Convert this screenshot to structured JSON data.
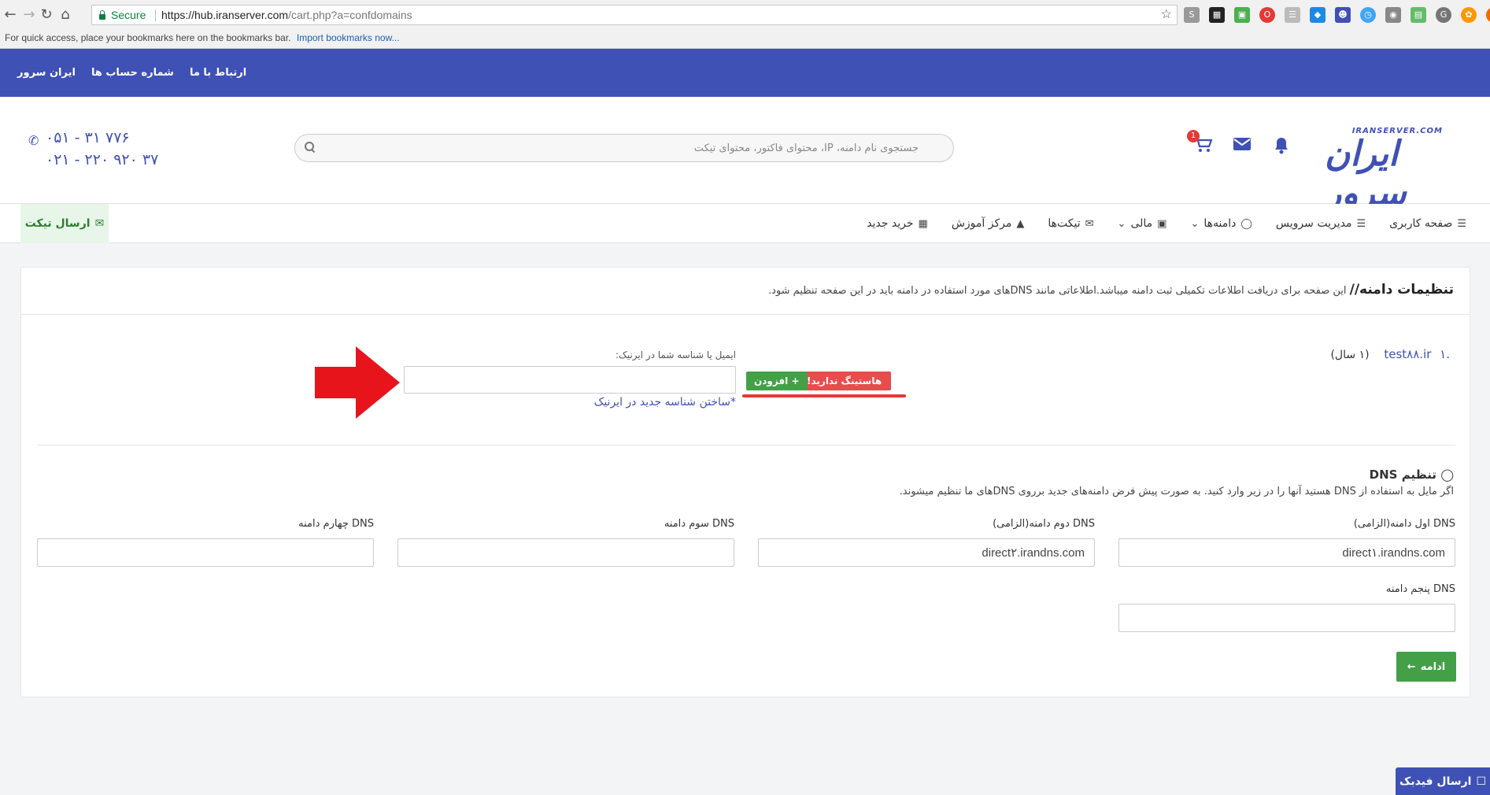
{
  "browser": {
    "secure_label": "Secure",
    "url_host": "https://hub.iranserver.com",
    "url_path": "/cart.php?a=confdomains",
    "bookmarks_hint": "For quick access, place your bookmarks here on the bookmarks bar.",
    "bookmarks_link": "Import bookmarks now..."
  },
  "topbar": {
    "links": [
      "ایران سرور",
      "شماره حساب ها",
      "ارتباط با ما"
    ]
  },
  "header": {
    "logo_tag": "IRANSERVER.COM",
    "logo_text": "ایران سرور",
    "cart_badge": "1",
    "search_placeholder": "جستجوی نام دامنه، IP، محتوای فاکتور، محتوای تیکت",
    "phone_1": "۰۵۱ - ۳۱ ۷۷۶",
    "phone_2": "۰۲۱ - ۲۲۰ ۹۲۰ ۳۷"
  },
  "nav": {
    "items": [
      {
        "label": "صفحه کاربری",
        "icon": "bars-icon"
      },
      {
        "label": "مدیریت سرویس",
        "icon": "list-icon"
      },
      {
        "label": "دامنه‌ها",
        "icon": "globe-icon"
      },
      {
        "label": "مالی",
        "icon": "briefcase-icon"
      },
      {
        "label": "تیکت‌ها",
        "icon": "comments-icon"
      },
      {
        "label": "مرکز آموزش",
        "icon": "graduation-cap-icon"
      },
      {
        "label": "خرید جدید",
        "icon": "grid-icon"
      }
    ],
    "send_ticket": "ارسال تیکت"
  },
  "card": {
    "title": "تنظیمات دامنه//",
    "subtitle": " این صفحه برای دریافت اطلاعات تکمیلی ثبت دامنه میباشد.اطلاعاتی مانند DNSهای مورد استفاده در دامنه باید در این صفحه تنظیم شود.",
    "domain_num": ".۱",
    "domain_name": "test۸۸.ir",
    "domain_years": "(۱ سال)",
    "hosting_button": "هاستینگ ندارید!",
    "add_button": "+ افزودن",
    "irnic_label": "ایمیل یا شناسه شما در ایرنیک:",
    "irnic_link": "*ساختن شناسه جدید در ایرنیک",
    "dns_title": "تنظیم DNS",
    "dns_desc": "اگر مایل به استفاده از DNS هستید آنها را در زیر وارد کنید. به صورت پیش فرض دامنه‌های جدید برروی DNSهای ما تنظیم میشوند.",
    "dns_fields": [
      {
        "label": "DNS اول دامنه(الزامی)",
        "value": "direct۱.irandns.com"
      },
      {
        "label": "DNS دوم دامنه(الزامی)",
        "value": "direct۲.irandns.com"
      },
      {
        "label": "DNS سوم دامنه",
        "value": ""
      },
      {
        "label": "DNS چهارم دامنه",
        "value": ""
      },
      {
        "label": "DNS پنجم دامنه",
        "value": ""
      }
    ],
    "continue_button": "ادامه"
  },
  "feedback": "ارسال فیدبک",
  "colors": {
    "primary": "#3f51b5",
    "success": "#43a047",
    "danger": "#e84c4c"
  }
}
